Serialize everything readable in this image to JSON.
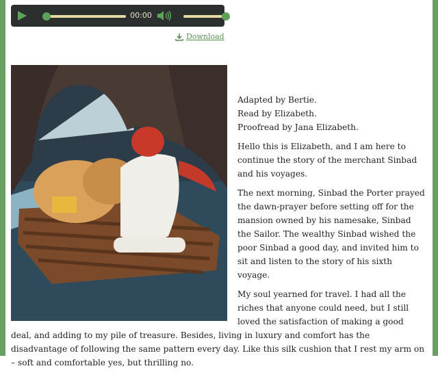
{
  "player": {
    "time": "00:00",
    "seek_progress": 0.0,
    "volume_level": 1.0
  },
  "download": {
    "label": "Download"
  },
  "story": {
    "credits": [
      "Adapted by Bertie.",
      "Read by Elizabeth.",
      "Proofread by Jana Elizabeth."
    ],
    "paragraphs": [
      "Hello this is Elizabeth, and I am here to continue the story of the merchant Sinbad and his voyages.",
      "The next morning, Sinbad the Porter prayed the dawn-prayer before setting off for the mansion owned by his namesake, Sinbad the Sailor. The wealthy Sinbad wished the poor Sinbad a good day, and invited him to sit and listen to the story of his sixth voyage.",
      "My soul yearned for travel. I had all the riches that anyone could need, but I still loved the satisfaction of making a good deal, and adding to my pile of treasure. Besides, living in luxury and comfort has the disadvantage of following the same pattern every day. Like this silk cushion that I rest my arm on – soft and comfortable yes, but thrilling no."
    ]
  },
  "colors": {
    "frame": "#6a9f64",
    "player_bg": "#2b2f2e",
    "accent": "#5ea159",
    "track": "#e7d9a2"
  }
}
